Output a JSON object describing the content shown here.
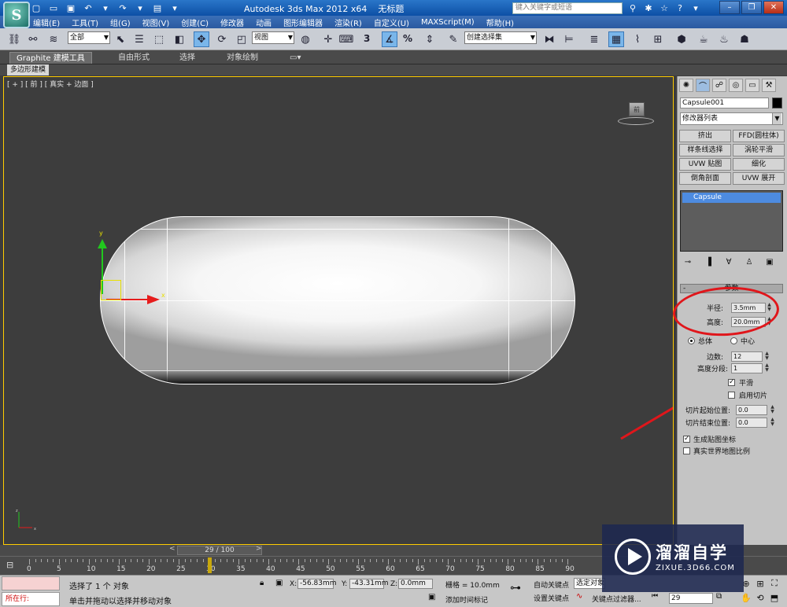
{
  "titlebar": {
    "app_title": "Autodesk 3ds Max  2012 x64",
    "doc_title": "无标题",
    "search_placeholder": "键入关键字或短语",
    "logo_letter": "S"
  },
  "menu": [
    "编辑(E)",
    "工具(T)",
    "组(G)",
    "视图(V)",
    "创建(C)",
    "修改器",
    "动画",
    "图形编辑器",
    "渲染(R)",
    "自定义(U)",
    "MAXScript(M)",
    "帮助(H)"
  ],
  "toolbar": {
    "selection_filter": "全部",
    "ref_coord": "视图",
    "named_selection": "创建选择集"
  },
  "ribbon": {
    "tabs": [
      "Graphite 建模工具",
      "自由形式",
      "选择",
      "对象绘制"
    ],
    "sub_label": "多边形建模"
  },
  "viewport": {
    "label": "[ + ] [ 前 ] [ 真实 + 边面 ]",
    "viewcube_face": "前"
  },
  "command_panel": {
    "object_name": "Capsule001",
    "modifier_list": "修改器列表",
    "modifier_buttons": [
      "挤出",
      "FFD(圆柱体)",
      "样条线选择",
      "涡轮平滑",
      "UVW 贴图",
      "细化",
      "倒角剖面",
      "UVW 展开"
    ],
    "stack_item": "Capsule",
    "params_title": "参数",
    "radius_label": "半径:",
    "radius_value": "3.5mm",
    "height_label": "高度:",
    "height_value": "20.0mm",
    "radio_overall": "总体",
    "radio_center": "中心",
    "sides_label": "边数:",
    "sides_value": "12",
    "height_segs_label": "高度分段:",
    "height_segs_value": "1",
    "smooth_label": "平滑",
    "slice_on_label": "启用切片",
    "slice_from_label": "切片起始位置:",
    "slice_from_value": "0.0",
    "slice_to_label": "切片结束位置:",
    "slice_to_value": "0.0",
    "gen_map_label": "生成贴图坐标",
    "real_world_label": "真实世界地图比例"
  },
  "timeline": {
    "frame_display": "29 / 100",
    "current_frame": 29,
    "total_frames": 100,
    "ticks": [
      "0",
      "5",
      "10",
      "15",
      "20",
      "25",
      "30",
      "35",
      "40",
      "45",
      "50",
      "55",
      "60",
      "65",
      "70",
      "75",
      "80",
      "85",
      "90"
    ]
  },
  "status": {
    "now_label": "所在行:",
    "selected_text": "选择了 1 个 对象",
    "prompt_text": "单击并拖动以选择并移动对象",
    "x_label": "X:",
    "x_value": "-56.83mm",
    "y_label": "Y:",
    "y_value": "-43.31mm",
    "z_label": "Z:",
    "z_value": "0.0mm",
    "grid_text": "栅格 = 10.0mm",
    "add_time_tag": "添加时间标记",
    "auto_key": "自动关键点",
    "set_key": "设置关键点",
    "selected_obj": "选定对象",
    "key_filters": "关键点过滤器...",
    "frame_field": "29"
  },
  "watermark": {
    "title": "溜溜自学",
    "url": "ZIXUE.3D66.COM"
  },
  "colors": {
    "annotation_red": "#e0161b",
    "gizmo_x": "#e61c1c",
    "gizmo_y": "#21c81e",
    "selection_yellow": "#e8e000"
  }
}
